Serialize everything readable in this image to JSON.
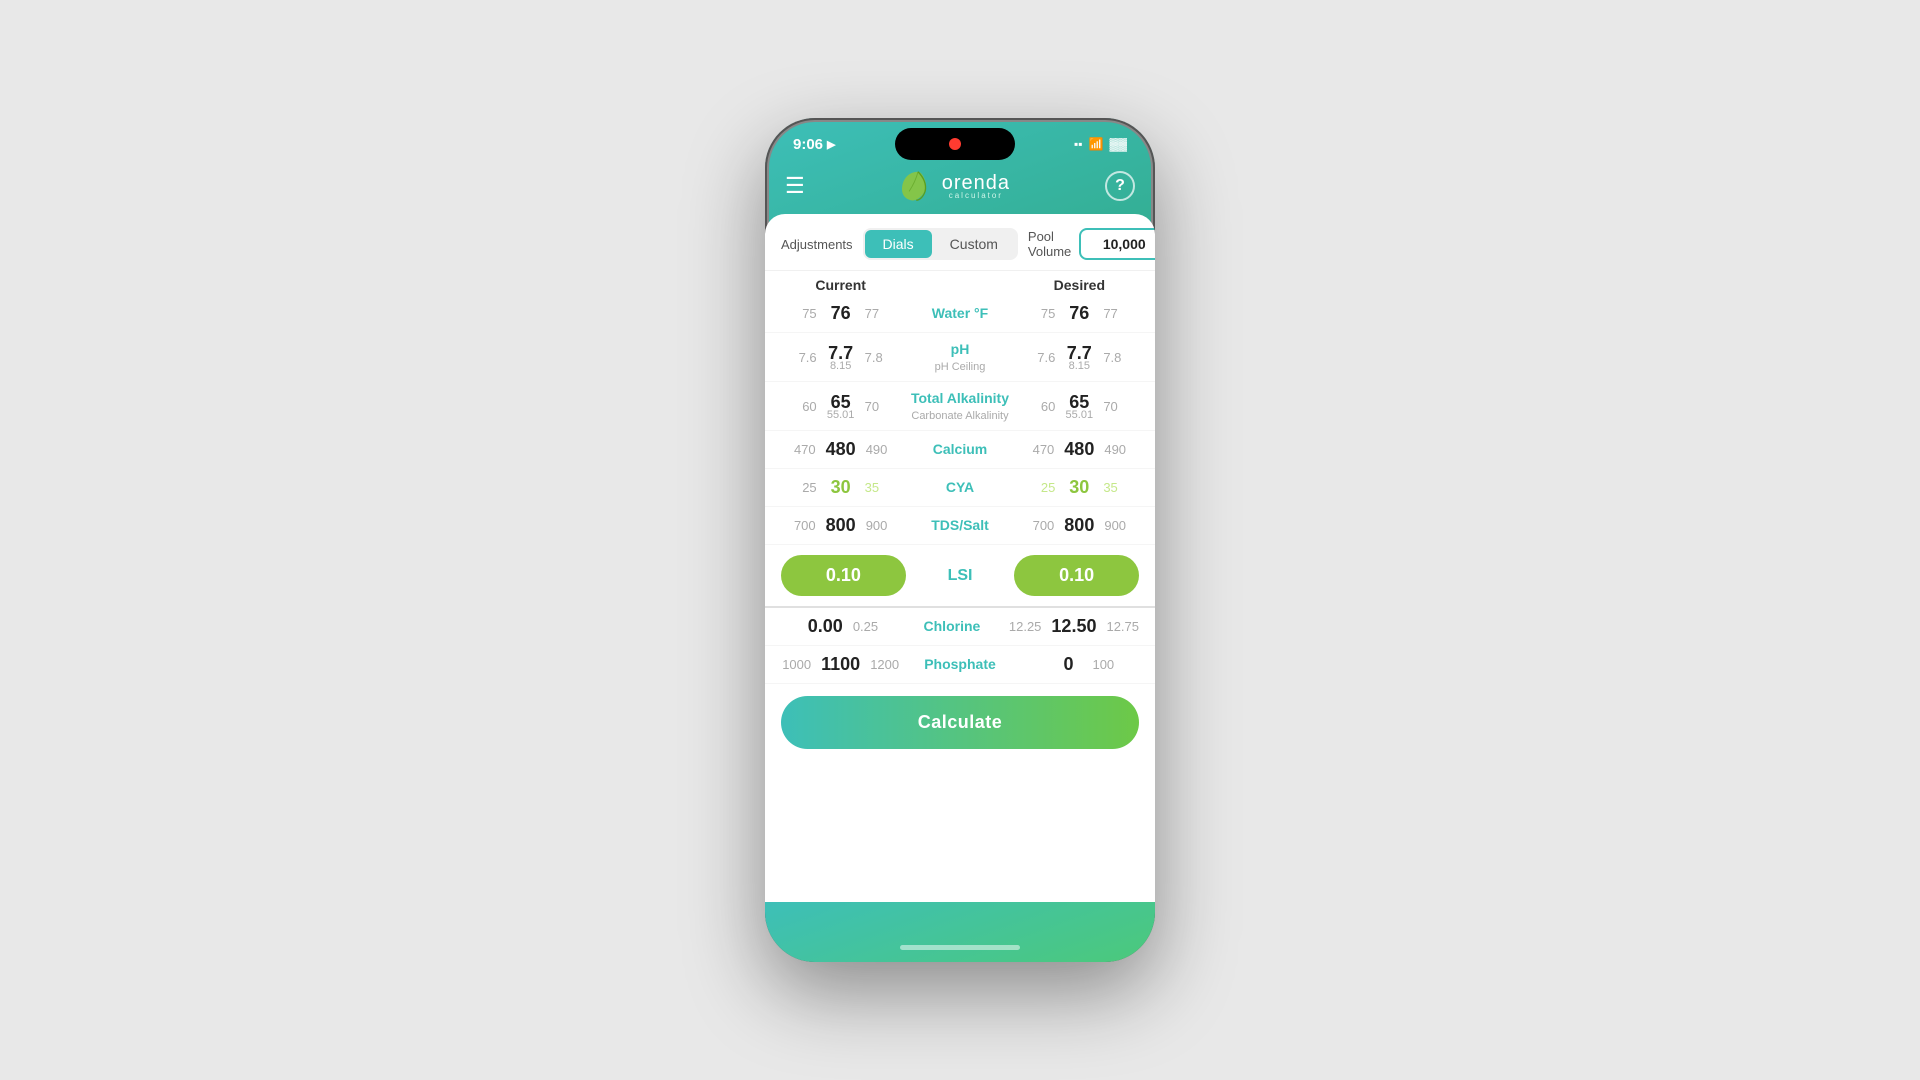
{
  "statusBar": {
    "time": "9:06",
    "locationIcon": "▶",
    "recordDot": true
  },
  "header": {
    "menuLabel": "☰",
    "logoText": "orenda",
    "logoSub": "calculator",
    "helpLabel": "?"
  },
  "tabs": {
    "adjustmentsLabel": "Adjustments",
    "poolVolumeLabel": "Pool Volume",
    "dialsBtnLabel": "Dials",
    "customBtnLabel": "Custom",
    "poolVolumeValue": "10,000"
  },
  "columns": {
    "currentLabel": "Current",
    "desiredLabel": "Desired"
  },
  "rows": [
    {
      "label": "Water °F",
      "sublabel": "",
      "currentLeft": "75",
      "currentCenter": "76",
      "currentRight": "77",
      "currentSub": "",
      "desiredLeft": "75",
      "desiredCenter": "76",
      "desiredRight": "77",
      "desiredSub": ""
    },
    {
      "label": "pH",
      "sublabel": "pH Ceiling",
      "currentLeft": "7.6",
      "currentCenter": "7.7",
      "currentRight": "7.8",
      "currentSub": "8.15",
      "desiredLeft": "7.6",
      "desiredCenter": "7.7",
      "desiredRight": "7.8",
      "desiredSub": "8.15"
    },
    {
      "label": "Total Alkalinity",
      "sublabel": "Carbonate Alkalinity",
      "currentLeft": "60",
      "currentCenter": "65",
      "currentRight": "70",
      "currentSub": "55.01",
      "desiredLeft": "60",
      "desiredCenter": "65",
      "desiredRight": "70",
      "desiredSub": "55.01"
    },
    {
      "label": "Calcium",
      "sublabel": "",
      "currentLeft": "470",
      "currentCenter": "480",
      "currentRight": "490",
      "currentSub": "",
      "desiredLeft": "470",
      "desiredCenter": "480",
      "desiredRight": "490",
      "desiredSub": ""
    },
    {
      "label": "CYA",
      "sublabel": "",
      "currentLeft": "25",
      "currentCenter": "30",
      "currentRight": "35",
      "currentSub": "",
      "desiredLeft": "25",
      "desiredCenter": "30",
      "desiredRight": "35",
      "desiredSub": ""
    },
    {
      "label": "TDS/Salt",
      "sublabel": "",
      "currentLeft": "700",
      "currentCenter": "800",
      "currentRight": "900",
      "currentSub": "",
      "desiredLeft": "700",
      "desiredCenter": "800",
      "desiredRight": "900",
      "desiredSub": ""
    }
  ],
  "lsi": {
    "label": "LSI",
    "currentValue": "0.10",
    "desiredValue": "0.10"
  },
  "belowRows": [
    {
      "label": "Chlorine",
      "sublabel": "",
      "currentLeft": "",
      "currentCenter": "0.00",
      "currentRight": "0.25",
      "currentSub": "",
      "desiredLeft": "12.25",
      "desiredCenter": "12.50",
      "desiredRight": "12.75",
      "desiredSub": ""
    },
    {
      "label": "Phosphate",
      "sublabel": "",
      "currentLeft": "1000",
      "currentCenter": "1100",
      "currentRight": "1200",
      "currentSub": "",
      "desiredLeft": "",
      "desiredCenter": "0",
      "desiredRight": "100",
      "desiredSub": ""
    }
  ],
  "calculateBtn": "Calculate"
}
